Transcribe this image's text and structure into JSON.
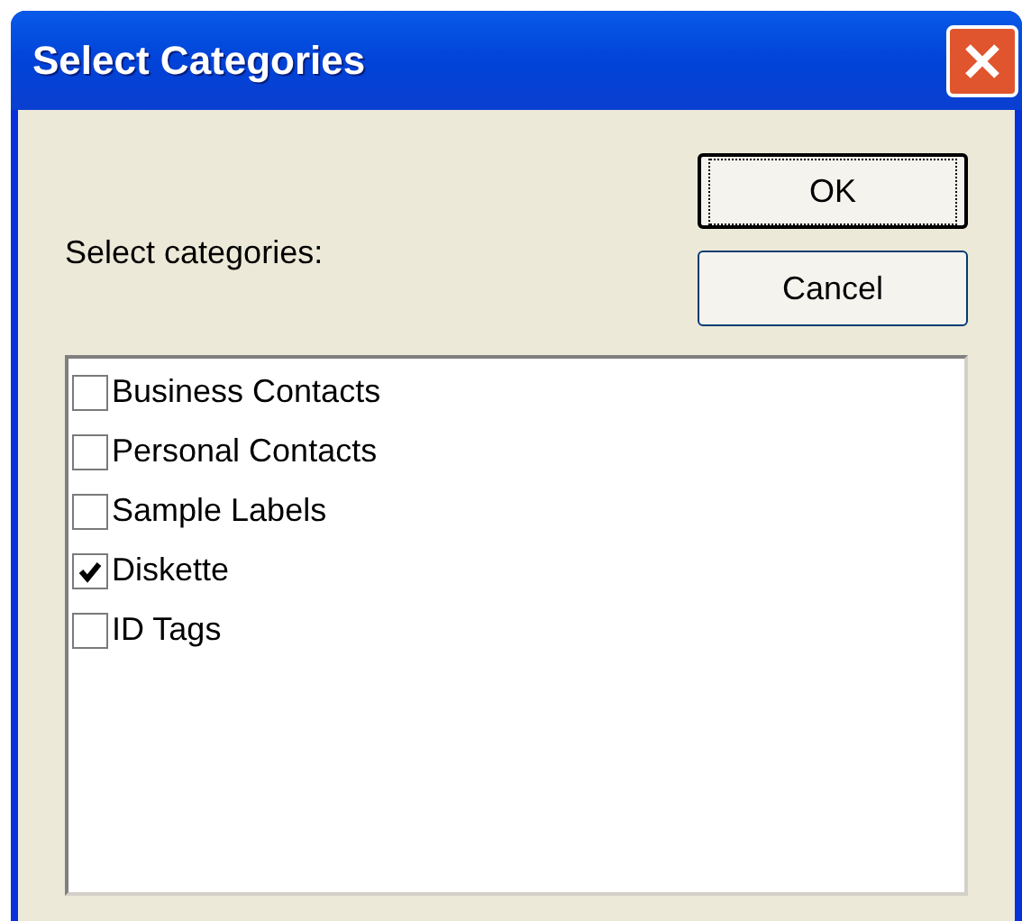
{
  "window": {
    "title": "Select Categories"
  },
  "label": "Select categories:",
  "buttons": [
    {
      "label": "OK",
      "selected": true
    },
    {
      "label": "Cancel",
      "selected": false
    }
  ],
  "categories": [
    {
      "label": "Business Contacts",
      "checked": false
    },
    {
      "label": "Personal Contacts",
      "checked": false
    },
    {
      "label": "Sample Labels",
      "checked": false
    },
    {
      "label": "Diskette",
      "checked": true
    },
    {
      "label": "ID Tags",
      "checked": false
    }
  ]
}
